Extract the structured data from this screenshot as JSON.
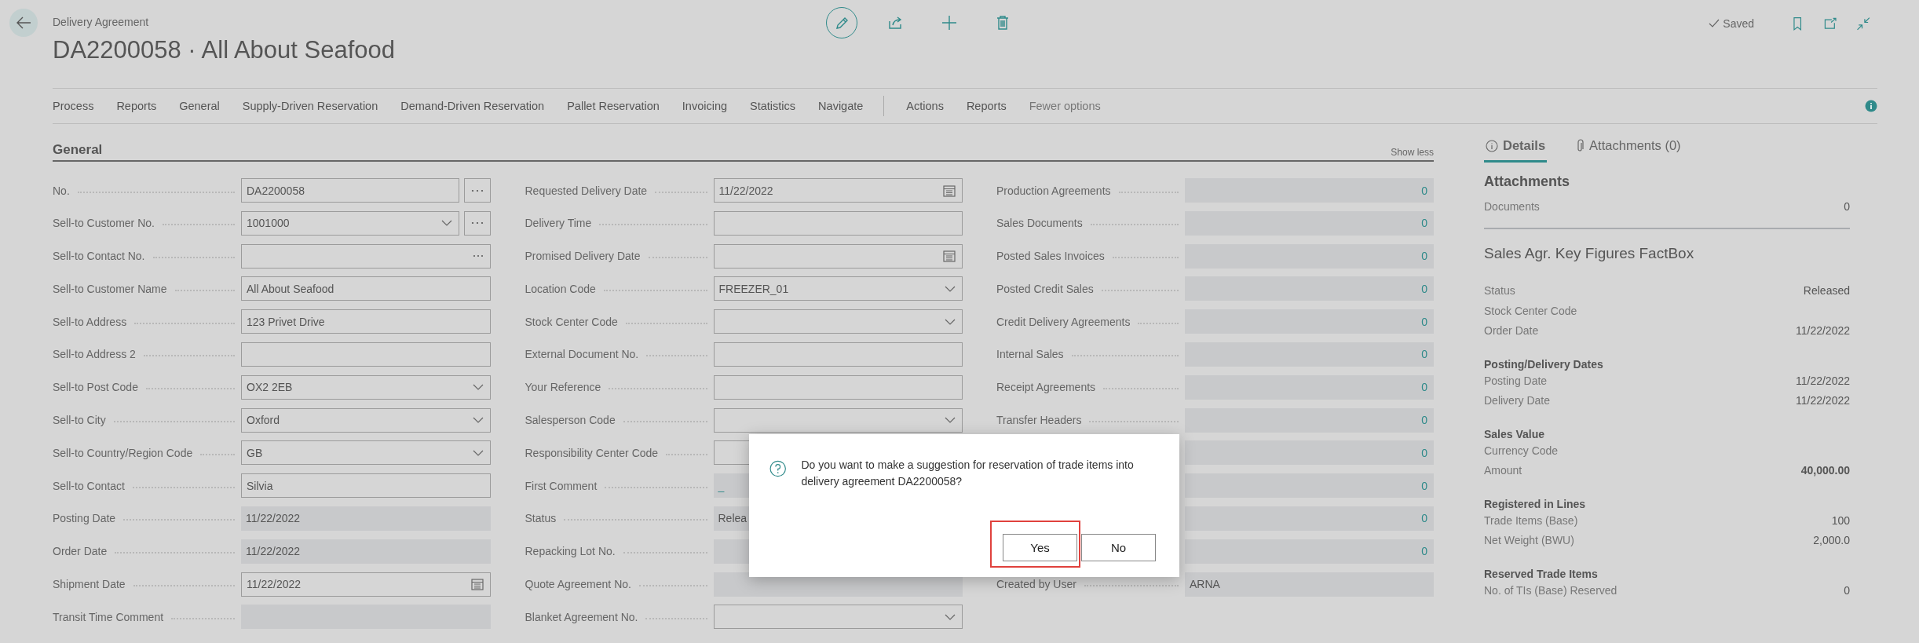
{
  "header": {
    "subtitle": "Delivery Agreement",
    "title": "DA2200058 · All About Seafood",
    "actions": [
      {
        "kind": "edit",
        "circled": true
      },
      {
        "kind": "share",
        "circled": false
      },
      {
        "kind": "new",
        "circled": false
      },
      {
        "kind": "delete",
        "circled": false
      }
    ],
    "saved": "Saved",
    "tools": [
      {
        "kind": "bookmark"
      },
      {
        "kind": "popout"
      },
      {
        "kind": "collapse"
      }
    ]
  },
  "nav": {
    "items": [
      {
        "kind": "item",
        "label": "Process",
        "muted": false
      },
      {
        "kind": "item",
        "label": "Reports",
        "muted": false
      },
      {
        "kind": "item",
        "label": "General",
        "muted": false
      },
      {
        "kind": "item",
        "label": "Supply-Driven Reservation",
        "muted": false
      },
      {
        "kind": "item",
        "label": "Demand-Driven Reservation",
        "muted": false
      },
      {
        "kind": "item",
        "label": "Pallet Reservation",
        "muted": false
      },
      {
        "kind": "item",
        "label": "Invoicing",
        "muted": false
      },
      {
        "kind": "item",
        "label": "Statistics",
        "muted": false
      },
      {
        "kind": "item",
        "label": "Navigate",
        "muted": false
      },
      {
        "kind": "separator"
      },
      {
        "kind": "item",
        "label": "Actions",
        "muted": false
      },
      {
        "kind": "item",
        "label": "Reports",
        "muted": false
      },
      {
        "kind": "item",
        "label": "Fewer options",
        "muted": true
      }
    ]
  },
  "general": {
    "title": "General",
    "toggle": "Show less",
    "columns": [
      [
        {
          "label": "No.",
          "value": "DA2200058",
          "kind": "text",
          "editable": true,
          "assist": true
        },
        {
          "label": "Sell-to Customer No.",
          "value": "1001000",
          "kind": "dropdown",
          "editable": true,
          "assist": true
        },
        {
          "label": "Sell-to Contact No.",
          "kind": "lookup",
          "editable": true,
          "assist": false
        },
        {
          "label": "Sell-to Customer Name",
          "value": "All About Seafood",
          "kind": "text",
          "editable": true,
          "assist": false
        },
        {
          "label": "Sell-to Address",
          "value": "123 Privet Drive",
          "kind": "text",
          "editable": true,
          "assist": false
        },
        {
          "label": "Sell-to Address 2",
          "kind": "text",
          "editable": true,
          "assist": false
        },
        {
          "label": "Sell-to Post Code",
          "value": "OX2 2EB",
          "kind": "dropdown",
          "editable": true,
          "assist": false
        },
        {
          "label": "Sell-to City",
          "value": "Oxford",
          "kind": "dropdown",
          "editable": true,
          "assist": false
        },
        {
          "label": "Sell-to Country/Region Code",
          "value": "GB",
          "kind": "dropdown",
          "editable": true,
          "assist": false
        },
        {
          "label": "Sell-to Contact",
          "value": "Silvia",
          "kind": "text",
          "editable": true,
          "assist": false
        },
        {
          "label": "Posting Date",
          "value": "11/22/2022",
          "kind": "text",
          "editable": false,
          "assist": false
        },
        {
          "label": "Order Date",
          "value": "11/22/2022",
          "kind": "text",
          "editable": false,
          "assist": false
        },
        {
          "label": "Shipment Date",
          "value": "11/22/2022",
          "kind": "date",
          "editable": true,
          "assist": false
        },
        {
          "label": "Transit Time Comment",
          "kind": "text",
          "editable": false,
          "assist": false
        }
      ],
      [
        {
          "label": "Requested Delivery Date",
          "value": "11/22/2022",
          "kind": "date",
          "editable": true,
          "assist": false
        },
        {
          "label": "Delivery Time",
          "kind": "text",
          "editable": true,
          "assist": false
        },
        {
          "label": "Promised Delivery Date",
          "kind": "date",
          "editable": true,
          "assist": false
        },
        {
          "label": "Location Code",
          "value": "FREEZER_01",
          "kind": "dropdown",
          "editable": true,
          "assist": false
        },
        {
          "label": "Stock Center Code",
          "kind": "dropdown",
          "editable": true,
          "assist": false
        },
        {
          "label": "External Document No.",
          "kind": "text",
          "editable": true,
          "assist": false
        },
        {
          "label": "Your Reference",
          "kind": "text",
          "editable": true,
          "assist": false
        },
        {
          "label": "Salesperson Code",
          "kind": "dropdown",
          "editable": true,
          "assist": false
        },
        {
          "label": "Responsibility Center Code",
          "kind": "text",
          "editable": true,
          "assist": false
        },
        {
          "label": "First Comment",
          "value": "_",
          "kind": "link",
          "editable": false,
          "assist": false
        },
        {
          "label": "Status",
          "value": "Relea",
          "kind": "text",
          "editable": false,
          "assist": false
        },
        {
          "label": "Repacking Lot No.",
          "kind": "text",
          "editable": false,
          "assist": false
        },
        {
          "label": "Quote Agreement No.",
          "kind": "text",
          "editable": false,
          "assist": false
        },
        {
          "label": "Blanket Agreement No.",
          "kind": "dropdown",
          "editable": true,
          "assist": false
        }
      ],
      [
        {
          "label": "Production Agreements",
          "value": "0",
          "kind": "count",
          "editable": false,
          "assist": false
        },
        {
          "label": "Sales Documents",
          "value": "0",
          "kind": "count",
          "editable": false,
          "assist": false
        },
        {
          "label": "Posted Sales Invoices",
          "value": "0",
          "kind": "count",
          "editable": false,
          "assist": false
        },
        {
          "label": "Posted Credit Sales",
          "value": "0",
          "kind": "count",
          "editable": false,
          "assist": false
        },
        {
          "label": "Credit Delivery Agreements",
          "value": "0",
          "kind": "count",
          "editable": false,
          "assist": false
        },
        {
          "label": "Internal Sales",
          "value": "0",
          "kind": "count",
          "editable": false,
          "assist": false
        },
        {
          "label": "Receipt Agreements",
          "value": "0",
          "kind": "count",
          "editable": false,
          "assist": false
        },
        {
          "label": "Transfer Headers",
          "value": "0",
          "kind": "count",
          "editable": false,
          "assist": false
        },
        {
          "value": "0",
          "kind": "count",
          "editable": false,
          "assist": false
        },
        {
          "value": "0",
          "kind": "count",
          "editable": false,
          "assist": false
        },
        {
          "value": "0",
          "kind": "count",
          "editable": false,
          "assist": false
        },
        {
          "value": "0",
          "kind": "count",
          "editable": false,
          "assist": false
        },
        {
          "label": "Created by User",
          "value": "ARNA",
          "kind": "text",
          "editable": false,
          "assist": false
        }
      ]
    ]
  },
  "factbox": {
    "tabs": [
      {
        "label": "Details",
        "kind": "info",
        "selected": true
      },
      {
        "label": "Attachments (0)",
        "kind": "attachments",
        "selected": false
      }
    ],
    "attachments": {
      "title": "Attachments",
      "rows": [
        {
          "label": "Documents",
          "value": "0",
          "kind": "link"
        }
      ]
    },
    "key_figures": {
      "title": "Sales Agr. Key Figures FactBox",
      "groups": [
        {
          "rows": [
            {
              "label": "Status",
              "value": "Released",
              "kind": "plain"
            },
            {
              "label": "Stock Center Code"
            },
            {
              "label": "Order Date",
              "value": "11/22/2022",
              "kind": "plain"
            }
          ]
        },
        {
          "heading": "Posting/Delivery Dates",
          "rows": [
            {
              "label": "Posting Date",
              "value": "11/22/2022",
              "kind": "plain"
            },
            {
              "label": "Delivery Date",
              "value": "11/22/2022",
              "kind": "plain"
            }
          ]
        },
        {
          "heading": "Sales Value",
          "rows": [
            {
              "label": "Currency Code"
            },
            {
              "label": "Amount",
              "value": "40,000.00",
              "kind": "total"
            }
          ]
        },
        {
          "heading": "Registered in Lines",
          "rows": [
            {
              "label": "Trade Items (Base)",
              "value": "100",
              "kind": "link"
            },
            {
              "label": "Net Weight (BWU)",
              "value": "2,000.0",
              "kind": "link"
            }
          ]
        },
        {
          "heading": "Reserved Trade Items",
          "rows": [
            {
              "label": "No. of TIs (Base) Reserved",
              "value": "0",
              "kind": "link"
            }
          ]
        }
      ]
    }
  },
  "dialog": {
    "message": "Do you want to make a suggestion for reservation of trade items into delivery agreement DA2200058?",
    "buttons": [
      {
        "label": "Yes",
        "highlighted": true
      },
      {
        "label": "No",
        "highlighted": false
      }
    ]
  }
}
